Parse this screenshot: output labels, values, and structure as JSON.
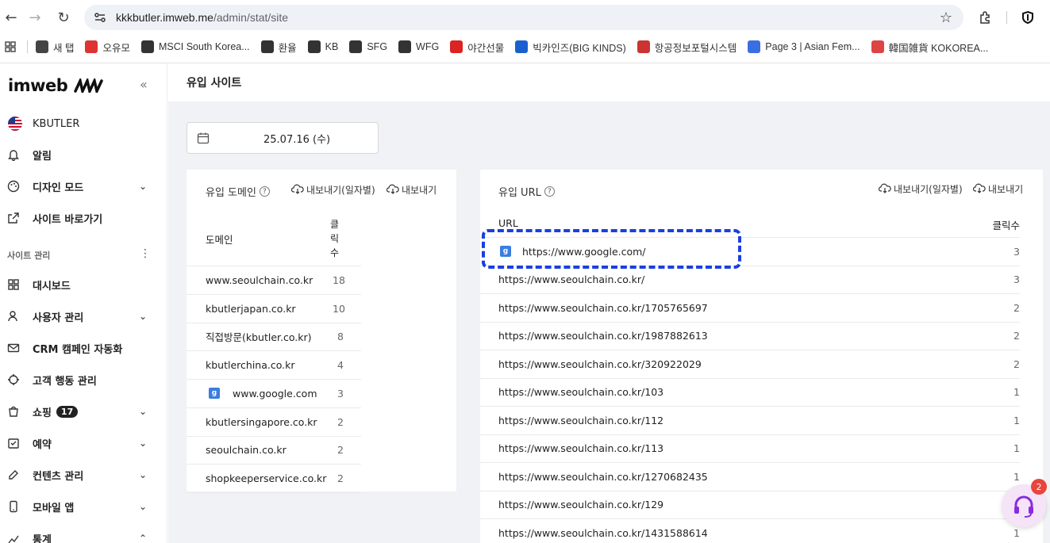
{
  "browser": {
    "url_host": "kkkbutler.imweb.me",
    "url_path": "/admin/stat/site",
    "bookmarks": [
      {
        "label": "새 탭",
        "color": "#444444"
      },
      {
        "label": "오유모",
        "color": "#d33"
      },
      {
        "label": "MSCI South Korea...",
        "color": "#333333"
      },
      {
        "label": "환율",
        "color": "#333333"
      },
      {
        "label": "KB",
        "color": "#333333"
      },
      {
        "label": "SFG",
        "color": "#333333"
      },
      {
        "label": "WFG",
        "color": "#333333"
      },
      {
        "label": "야간선물",
        "color": "#d22"
      },
      {
        "label": "빅카인즈(BIG KINDS)",
        "color": "#1a5fd0"
      },
      {
        "label": "항공정보포털시스템",
        "color": "#c33"
      },
      {
        "label": "Page 3 | Asian Fem...",
        "color": "#3b6ee0"
      },
      {
        "label": "韓国雑貨 KOKOREA...",
        "color": "#d44"
      }
    ]
  },
  "sidebar": {
    "logo": "imweb",
    "site_name": "KBUTLER",
    "items_top": [
      {
        "label": "알림",
        "icon": "bell-icon"
      },
      {
        "label": "디자인 모드",
        "icon": "palette-icon",
        "has_chevron": true
      },
      {
        "label": "사이트 바로가기",
        "icon": "external-link-icon"
      }
    ],
    "section_label": "사이트 관리",
    "items": [
      {
        "label": "대시보드",
        "icon": "grid-icon"
      },
      {
        "label": "사용자 관리",
        "icon": "user-icon",
        "has_chevron": true
      },
      {
        "label": "CRM 캠페인 자동화",
        "icon": "mail-icon"
      },
      {
        "label": "고객 행동 관리",
        "icon": "target-icon"
      },
      {
        "label": "쇼핑",
        "icon": "bag-icon",
        "badge": "17",
        "has_chevron": true
      },
      {
        "label": "예약",
        "icon": "calendar-check-icon",
        "has_chevron": true
      },
      {
        "label": "컨텐츠 관리",
        "icon": "edit-icon",
        "has_chevron": true
      },
      {
        "label": "모바일 앱",
        "icon": "mobile-icon",
        "has_chevron": true
      },
      {
        "label": "통계",
        "icon": "chart-icon",
        "has_chevron": true
      }
    ]
  },
  "main": {
    "page_title": "유입 사이트",
    "date": "25.07.16 (수)",
    "domain_card": {
      "title": "유입 도메인",
      "export_daily": "내보내기(일자별)",
      "export": "내보내기",
      "col_domain": "도메인",
      "col_clicks": "클\n릭\n수",
      "rows": [
        {
          "domain": "www.seoulchain.co.kr",
          "clicks": "18",
          "google": false
        },
        {
          "domain": "kbutlerjapan.co.kr",
          "clicks": "10",
          "google": false
        },
        {
          "domain": "직접방문(kbutler.co.kr)",
          "clicks": "8",
          "google": false
        },
        {
          "domain": "kbutlerchina.co.kr",
          "clicks": "4",
          "google": false
        },
        {
          "domain": "www.google.com",
          "clicks": "3",
          "google": true
        },
        {
          "domain": "kbutlersingapore.co.kr",
          "clicks": "2",
          "google": false
        },
        {
          "domain": "seoulchain.co.kr",
          "clicks": "2",
          "google": false
        },
        {
          "domain": "shopkeeperservice.co.kr",
          "clicks": "2",
          "google": false
        }
      ]
    },
    "url_card": {
      "title": "유입 URL",
      "export_daily": "내보내기(일자별)",
      "export": "내보내기",
      "col_url": "URL",
      "col_clicks": "클릭수",
      "rows": [
        {
          "url": "https://www.google.com/",
          "clicks": "3",
          "google": true
        },
        {
          "url": "https://www.seoulchain.co.kr/",
          "clicks": "3",
          "google": false
        },
        {
          "url": "https://www.seoulchain.co.kr/1705765697",
          "clicks": "2",
          "google": false
        },
        {
          "url": "https://www.seoulchain.co.kr/1987882613",
          "clicks": "2",
          "google": false
        },
        {
          "url": "https://www.seoulchain.co.kr/320922029",
          "clicks": "2",
          "google": false
        },
        {
          "url": "https://www.seoulchain.co.kr/103",
          "clicks": "1",
          "google": false
        },
        {
          "url": "https://www.seoulchain.co.kr/112",
          "clicks": "1",
          "google": false
        },
        {
          "url": "https://www.seoulchain.co.kr/113",
          "clicks": "1",
          "google": false
        },
        {
          "url": "https://www.seoulchain.co.kr/1270682435",
          "clicks": "1",
          "google": false
        },
        {
          "url": "https://www.seoulchain.co.kr/129",
          "clicks": "1",
          "google": false
        },
        {
          "url": "https://www.seoulchain.co.kr/1431588614",
          "clicks": "1",
          "google": false
        }
      ]
    }
  },
  "support": {
    "badge": "2"
  }
}
